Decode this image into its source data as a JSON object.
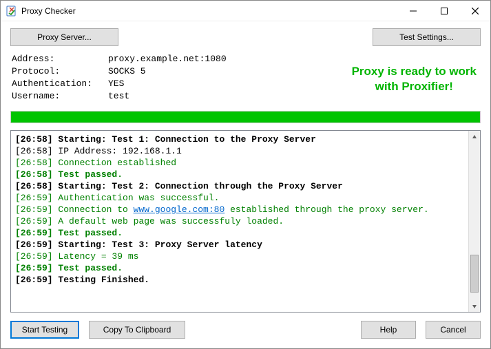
{
  "window": {
    "title": "Proxy Checker"
  },
  "topButtons": {
    "proxyServer": "Proxy Server...",
    "testSettings": "Test Settings..."
  },
  "info": {
    "label_address": "Address:",
    "val_address": "proxy.example.net:1080",
    "label_protocol": "Protocol:",
    "val_protocol": "SOCKS 5",
    "label_auth": "Authentication:",
    "val_auth": "YES",
    "label_user": "Username:",
    "val_user": "test"
  },
  "readyBanner": {
    "line1": "Proxy is ready to work",
    "line2": "with Proxifier!"
  },
  "log": [
    {
      "ts": "[26:58]",
      "style": "black bold",
      "text": "Starting: Test 1: Connection to the Proxy Server"
    },
    {
      "ts": "[26:58]",
      "style": "black",
      "text": "IP Address: 192.168.1.1"
    },
    {
      "ts": "[26:58]",
      "style": "green",
      "text": "Connection established"
    },
    {
      "ts": "[26:58]",
      "style": "green bold",
      "text": "Test passed."
    },
    {
      "ts": "[26:58]",
      "style": "black bold",
      "text": "Starting: Test 2: Connection through the Proxy Server"
    },
    {
      "ts": "[26:59]",
      "style": "green",
      "text": "Authentication was successful."
    },
    {
      "ts": "[26:59]",
      "style": "green",
      "pre": "Connection to ",
      "link": "www.google.com:80",
      "post": " established through the proxy server."
    },
    {
      "ts": "[26:59]",
      "style": "green",
      "text": "A default web page was successfuly loaded."
    },
    {
      "ts": "[26:59]",
      "style": "green bold",
      "text": "Test passed."
    },
    {
      "ts": "[26:59]",
      "style": "black bold",
      "text": "Starting: Test 3: Proxy Server latency"
    },
    {
      "ts": "[26:59]",
      "style": "green",
      "text": "Latency = 39 ms"
    },
    {
      "ts": "[26:59]",
      "style": "green bold",
      "text": "Test passed."
    },
    {
      "ts": "[26:59]",
      "style": "black bold",
      "text": "Testing Finished."
    }
  ],
  "bottomButtons": {
    "startTesting": "Start Testing",
    "copyClipboard": "Copy To Clipboard",
    "help": "Help",
    "cancel": "Cancel"
  }
}
